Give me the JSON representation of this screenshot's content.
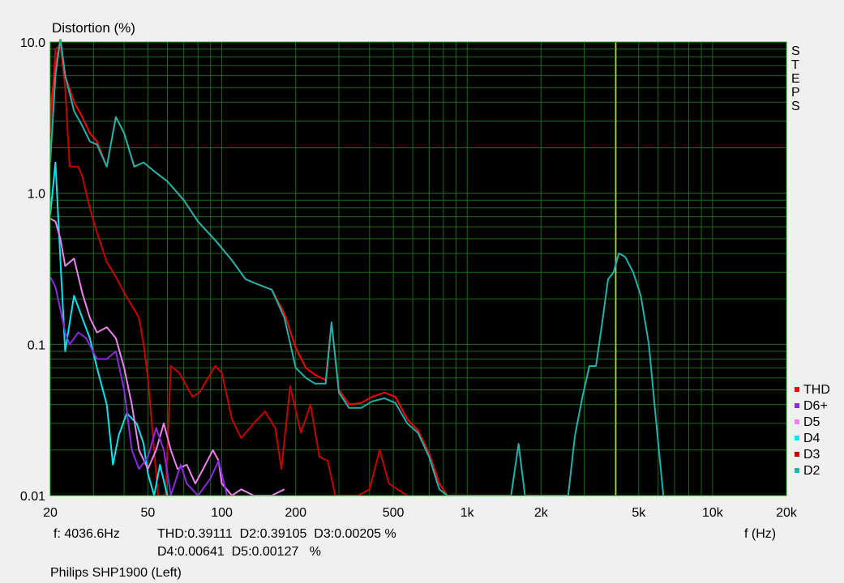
{
  "chart_data": {
    "type": "line",
    "title": "Distortion (%)",
    "xlabel": "f (Hz)",
    "x_scale": "log",
    "y_scale": "log",
    "xlim": [
      20,
      20000
    ],
    "ylim": [
      0.01,
      10.0
    ],
    "grid": true,
    "background": "#000000",
    "grid_color": "#1a6b1a",
    "marker_line": {
      "x": 4036.6,
      "color": "#c8c832"
    },
    "x_ticks": [
      {
        "value": 20,
        "label": "20"
      },
      {
        "value": 50,
        "label": "50"
      },
      {
        "value": 100,
        "label": "100"
      },
      {
        "value": 200,
        "label": "200"
      },
      {
        "value": 500,
        "label": "500"
      },
      {
        "value": 1000,
        "label": "1k"
      },
      {
        "value": 2000,
        "label": "2k"
      },
      {
        "value": 5000,
        "label": "5k"
      },
      {
        "value": 10000,
        "label": "10k"
      },
      {
        "value": 20000,
        "label": "20k"
      }
    ],
    "y_ticks": [
      {
        "value": 10,
        "label": "10.0"
      },
      {
        "value": 1,
        "label": "1.0"
      },
      {
        "value": 0.1,
        "label": "0.1"
      },
      {
        "value": 0.01,
        "label": "0.01"
      }
    ],
    "side_label": [
      "S",
      "T",
      "E",
      "P",
      "S"
    ],
    "legend_position": "bottom-right",
    "series": [
      {
        "name": "D3",
        "color": "#c80000",
        "points": [
          [
            20,
            2.5
          ],
          [
            21,
            9.0
          ],
          [
            22,
            9.5
          ],
          [
            23,
            5.0
          ],
          [
            24,
            1.5
          ],
          [
            26,
            1.5
          ],
          [
            27,
            1.3
          ],
          [
            29,
            0.8
          ],
          [
            31,
            0.55
          ],
          [
            34,
            0.35
          ],
          [
            37,
            0.28
          ],
          [
            40,
            0.22
          ],
          [
            44,
            0.17
          ],
          [
            46,
            0.15
          ],
          [
            48,
            0.1
          ],
          [
            50,
            0.06
          ],
          [
            53,
            0.02
          ],
          [
            55,
            0.01
          ],
          [
            59,
            0.01
          ],
          [
            62,
            0.072
          ],
          [
            67,
            0.065
          ],
          [
            71,
            0.055
          ],
          [
            76,
            0.045
          ],
          [
            81,
            0.048
          ],
          [
            88,
            0.06
          ],
          [
            94,
            0.072
          ],
          [
            100,
            0.065
          ],
          [
            110,
            0.032
          ],
          [
            120,
            0.024
          ],
          [
            130,
            0.028
          ],
          [
            140,
            0.032
          ],
          [
            150,
            0.036
          ],
          [
            165,
            0.028
          ],
          [
            175,
            0.015
          ],
          [
            190,
            0.053
          ],
          [
            210,
            0.026
          ],
          [
            230,
            0.04
          ],
          [
            250,
            0.018
          ],
          [
            270,
            0.017
          ],
          [
            290,
            0.01
          ],
          [
            320,
            0.008
          ],
          [
            360,
            0.01
          ],
          [
            400,
            0.011
          ],
          [
            440,
            0.02
          ],
          [
            480,
            0.012
          ],
          [
            520,
            0.011
          ],
          [
            570,
            0.01
          ]
        ]
      },
      {
        "name": "THD",
        "color": "#ff0000",
        "points": [
          [
            20,
            3.5
          ],
          [
            21,
            7.0
          ],
          [
            22,
            10.5
          ],
          [
            23,
            6.0
          ],
          [
            25,
            4.0
          ],
          [
            27,
            3.2
          ],
          [
            29,
            2.5
          ],
          [
            31,
            2.2
          ],
          [
            34,
            1.5
          ],
          [
            37,
            3.2
          ],
          [
            40,
            2.5
          ],
          [
            44,
            1.5
          ],
          [
            48,
            1.6
          ],
          [
            53,
            1.4
          ],
          [
            60,
            1.2
          ],
          [
            70,
            0.9
          ],
          [
            80,
            0.65
          ],
          [
            95,
            0.48
          ],
          [
            110,
            0.36
          ],
          [
            125,
            0.27
          ],
          [
            140,
            0.25
          ],
          [
            160,
            0.23
          ],
          [
            180,
            0.16
          ],
          [
            200,
            0.095
          ],
          [
            220,
            0.07
          ],
          [
            240,
            0.063
          ],
          [
            265,
            0.058
          ],
          [
            280,
            0.14
          ],
          [
            300,
            0.05
          ],
          [
            330,
            0.04
          ],
          [
            370,
            0.041
          ],
          [
            410,
            0.045
          ],
          [
            460,
            0.048
          ],
          [
            510,
            0.045
          ],
          [
            570,
            0.032
          ],
          [
            630,
            0.027
          ],
          [
            700,
            0.019
          ],
          [
            770,
            0.012
          ],
          [
            830,
            0.01
          ]
        ]
      },
      {
        "name": "D2",
        "color": "#20b2aa",
        "points": [
          [
            20,
            1.6
          ],
          [
            21,
            6.0
          ],
          [
            22,
            10.5
          ],
          [
            23,
            6.0
          ],
          [
            25,
            3.5
          ],
          [
            27,
            2.8
          ],
          [
            29,
            2.2
          ],
          [
            31,
            2.1
          ],
          [
            34,
            1.5
          ],
          [
            37,
            3.2
          ],
          [
            40,
            2.5
          ],
          [
            44,
            1.5
          ],
          [
            48,
            1.6
          ],
          [
            53,
            1.4
          ],
          [
            60,
            1.2
          ],
          [
            70,
            0.9
          ],
          [
            80,
            0.65
          ],
          [
            95,
            0.48
          ],
          [
            110,
            0.36
          ],
          [
            125,
            0.27
          ],
          [
            140,
            0.25
          ],
          [
            160,
            0.23
          ],
          [
            180,
            0.15
          ],
          [
            200,
            0.07
          ],
          [
            220,
            0.06
          ],
          [
            240,
            0.055
          ],
          [
            265,
            0.055
          ],
          [
            280,
            0.14
          ],
          [
            300,
            0.048
          ],
          [
            330,
            0.038
          ],
          [
            370,
            0.038
          ],
          [
            410,
            0.042
          ],
          [
            460,
            0.044
          ],
          [
            510,
            0.041
          ],
          [
            570,
            0.03
          ],
          [
            630,
            0.026
          ],
          [
            700,
            0.018
          ],
          [
            770,
            0.011
          ],
          [
            830,
            0.01
          ],
          [
            1510,
            0.01
          ],
          [
            1620,
            0.022
          ],
          [
            1720,
            0.01
          ],
          [
            2580,
            0.01
          ],
          [
            2750,
            0.025
          ],
          [
            2950,
            0.045
          ],
          [
            3150,
            0.072
          ],
          [
            3350,
            0.072
          ],
          [
            3550,
            0.14
          ],
          [
            3750,
            0.27
          ],
          [
            3950,
            0.3
          ],
          [
            4150,
            0.4
          ],
          [
            4400,
            0.38
          ],
          [
            4750,
            0.3
          ],
          [
            5100,
            0.21
          ],
          [
            5500,
            0.1
          ],
          [
            5900,
            0.03
          ],
          [
            6300,
            0.01
          ]
        ]
      },
      {
        "name": "D4",
        "color": "#00e5ee",
        "points": [
          [
            20,
            0.72
          ],
          [
            21,
            1.6
          ],
          [
            22,
            0.36
          ],
          [
            23,
            0.09
          ],
          [
            24,
            0.14
          ],
          [
            25,
            0.21
          ],
          [
            27,
            0.15
          ],
          [
            29,
            0.11
          ],
          [
            31,
            0.07
          ],
          [
            34,
            0.04
          ],
          [
            36,
            0.016
          ],
          [
            38,
            0.025
          ],
          [
            41,
            0.035
          ],
          [
            45,
            0.03
          ],
          [
            48,
            0.022
          ],
          [
            50,
            0.014
          ],
          [
            53,
            0.01
          ],
          [
            56,
            0.016
          ],
          [
            60,
            0.01
          ]
        ]
      },
      {
        "name": "D5",
        "color": "#ee82ee",
        "points": [
          [
            20,
            0.68
          ],
          [
            21,
            0.65
          ],
          [
            22,
            0.5
          ],
          [
            23,
            0.33
          ],
          [
            25,
            0.37
          ],
          [
            27,
            0.22
          ],
          [
            29,
            0.15
          ],
          [
            31,
            0.12
          ],
          [
            34,
            0.13
          ],
          [
            37,
            0.11
          ],
          [
            40,
            0.07
          ],
          [
            43,
            0.04
          ],
          [
            46,
            0.02
          ],
          [
            50,
            0.015
          ],
          [
            54,
            0.02
          ],
          [
            58,
            0.03
          ],
          [
            62,
            0.02
          ],
          [
            66,
            0.015
          ],
          [
            72,
            0.016
          ],
          [
            78,
            0.012
          ],
          [
            84,
            0.015
          ],
          [
            92,
            0.02
          ],
          [
            97,
            0.017
          ],
          [
            100,
            0.012
          ],
          [
            110,
            0.01
          ],
          [
            120,
            0.011
          ],
          [
            135,
            0.009
          ],
          [
            160,
            0.008
          ],
          [
            180,
            0.011
          ]
        ]
      },
      {
        "name": "D6+",
        "color": "#8a2be2",
        "points": [
          [
            20,
            0.28
          ],
          [
            21,
            0.24
          ],
          [
            22,
            0.17
          ],
          [
            23,
            0.12
          ],
          [
            24,
            0.1
          ],
          [
            26,
            0.12
          ],
          [
            28,
            0.11
          ],
          [
            31,
            0.08
          ],
          [
            34,
            0.08
          ],
          [
            37,
            0.09
          ],
          [
            40,
            0.05
          ],
          [
            43,
            0.02
          ],
          [
            46,
            0.015
          ],
          [
            50,
            0.018
          ],
          [
            54,
            0.028
          ],
          [
            58,
            0.02
          ],
          [
            62,
            0.01
          ],
          [
            68,
            0.016
          ],
          [
            72,
            0.012
          ],
          [
            80,
            0.01
          ],
          [
            90,
            0.013
          ],
          [
            97,
            0.017
          ],
          [
            105,
            0.01
          ]
        ]
      }
    ]
  },
  "legend": [
    {
      "name": "THD",
      "color": "#ff0000"
    },
    {
      "name": "D6+",
      "color": "#8a2be2"
    },
    {
      "name": "D5",
      "color": "#ee82ee"
    },
    {
      "name": "D4",
      "color": "#00e5ee"
    },
    {
      "name": "D3",
      "color": "#c80000"
    },
    {
      "name": "D2",
      "color": "#20b2aa"
    }
  ],
  "readout": {
    "freq": "f: 4036.6Hz",
    "line1": "THD:0.39111  D2:0.39105  D3:0.00205 %",
    "line2": "D4:0.00641  D5:0.00127   %"
  },
  "device_label": "Philips SHP1900 (Left)"
}
